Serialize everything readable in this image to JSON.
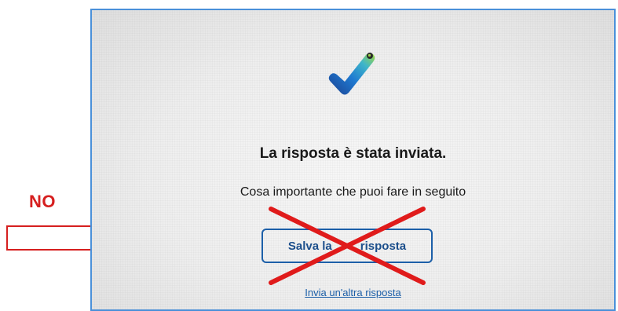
{
  "annotation": {
    "label": "NO",
    "label_color": "#d61f1f",
    "arrow_icon": "right-arrow-outline-icon",
    "cross_icon": "red-x-cross-icon",
    "cross_color": "#e01b1b"
  },
  "confirmation": {
    "check_icon": "checkmark-icon",
    "title": "La risposta è stata inviata.",
    "subtitle": "Cosa importante che puoi fare in seguito",
    "save_button_label": "Salva la tua risposta",
    "save_button_visible_label_left": "Salva la",
    "save_button_visible_label_right": "risposta",
    "another_response_link": "Invia un'altra risposta",
    "accent_color": "#1c5fa8"
  }
}
